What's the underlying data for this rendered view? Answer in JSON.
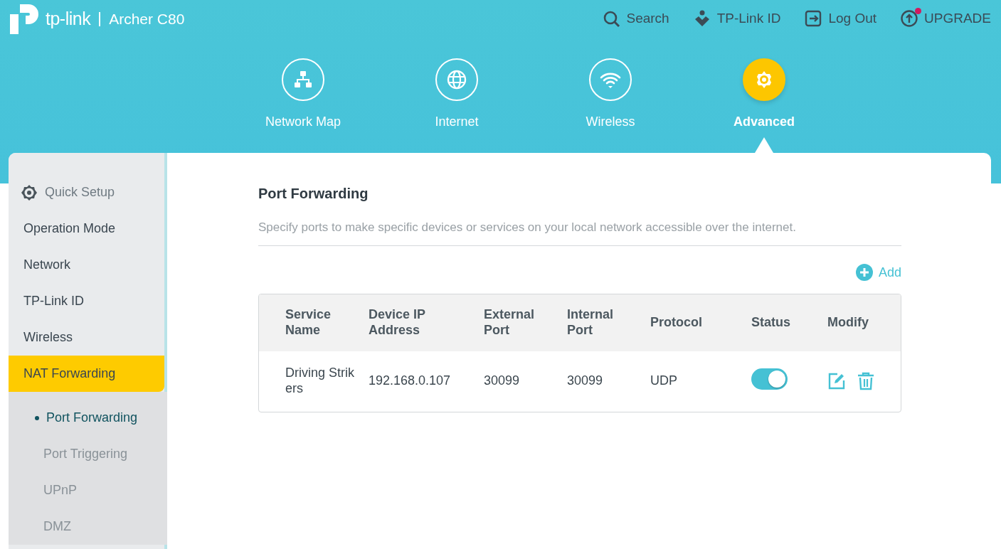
{
  "header": {
    "brand": "tp-link",
    "model": "Archer C80"
  },
  "top_links": [
    {
      "kind": "search",
      "label": "Search"
    },
    {
      "kind": "id",
      "label": "TP-Link ID"
    },
    {
      "kind": "logout",
      "label": "Log Out"
    },
    {
      "kind": "upgrade",
      "label": "UPGRADE",
      "notification": true
    }
  ],
  "nav_tabs": [
    {
      "kind": "map",
      "label": "Network Map",
      "selected": false
    },
    {
      "kind": "globe",
      "label": "Internet",
      "selected": false
    },
    {
      "kind": "wifi",
      "label": "Wireless",
      "selected": false
    },
    {
      "kind": "gear",
      "label": "Advanced",
      "selected": true
    }
  ],
  "sidebar": {
    "items": [
      {
        "label": "Quick Setup",
        "kind": "setup",
        "selected": false
      },
      {
        "label": "Operation Mode",
        "kind": "item",
        "selected": false
      },
      {
        "label": "Network",
        "kind": "item",
        "selected": false
      },
      {
        "label": "TP-Link ID",
        "kind": "item",
        "selected": false
      },
      {
        "label": "Wireless",
        "kind": "item",
        "selected": false
      },
      {
        "label": "NAT Forwarding",
        "kind": "item",
        "selected": true,
        "expanded": true,
        "children": [
          {
            "label": "Port Forwarding",
            "selected": true
          },
          {
            "label": "Port Triggering",
            "selected": false
          },
          {
            "label": "UPnP",
            "selected": false
          },
          {
            "label": "DMZ",
            "selected": false
          }
        ]
      }
    ]
  },
  "page": {
    "title": "Port Forwarding",
    "description": "Specify ports to make specific devices or services on your local network accessible over the internet.",
    "add_button": "Add"
  },
  "table": {
    "columns": [
      "Service Name",
      "Device IP Address",
      "External Port",
      "Internal Port",
      "Protocol",
      "Status",
      "Modify"
    ],
    "rows": [
      {
        "service_name": "Driving Strikers",
        "device_ip": "192.168.0.107",
        "external_port": "30099",
        "internal_port": "30099",
        "protocol": "UDP",
        "status_on": true
      }
    ]
  }
}
